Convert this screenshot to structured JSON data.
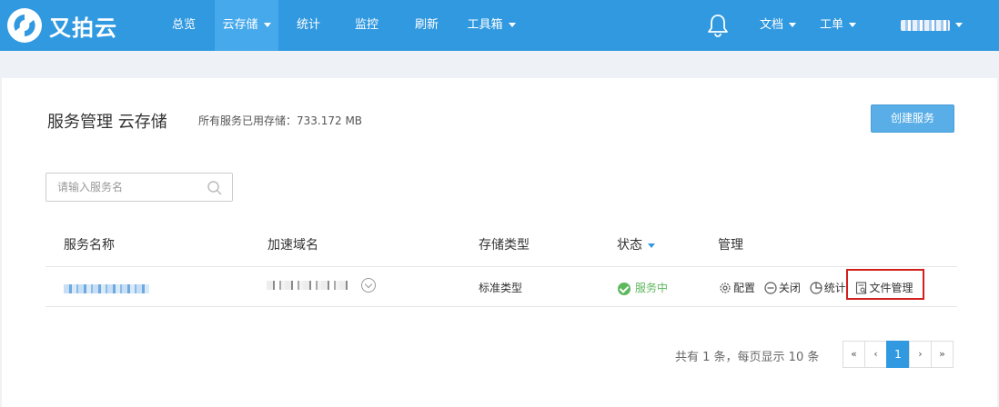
{
  "brand": {
    "name": "又拍云"
  },
  "nav": {
    "items": [
      {
        "label": "总览"
      },
      {
        "label": "云存储"
      },
      {
        "label": "统计"
      },
      {
        "label": "监控"
      },
      {
        "label": "刷新"
      },
      {
        "label": "工具箱"
      }
    ],
    "right": {
      "docs": "文档",
      "ticket": "工单"
    }
  },
  "page": {
    "title": "服务管理 云存储",
    "usage": "所有服务已用存储：733.172 MB",
    "create_button": "创建服务"
  },
  "search": {
    "placeholder": "请输入服务名"
  },
  "table": {
    "headers": [
      "服务名称",
      "加速域名",
      "存储类型",
      "状态",
      "管理"
    ],
    "rows": [
      {
        "storage_type": "标准类型",
        "status": "服务中",
        "ops": {
          "config": "配置",
          "close": "关闭",
          "stats": "统计",
          "files": "文件管理"
        }
      }
    ]
  },
  "pagination": {
    "info": "共有 1 条，每页显示 10 条",
    "first": "«",
    "prev": "‹",
    "current": "1",
    "next": "›",
    "last": "»"
  },
  "colors": {
    "primary": "#3199e0",
    "success": "#5cb85c",
    "highlight": "#d0211c"
  }
}
